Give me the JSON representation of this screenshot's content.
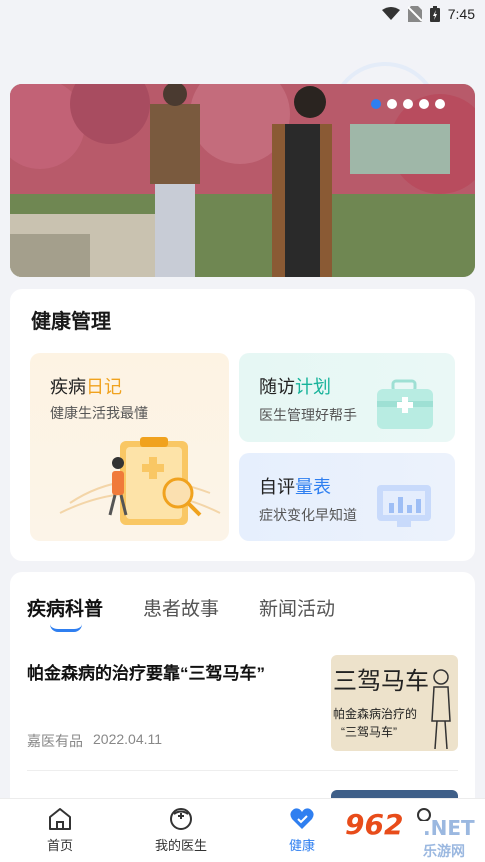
{
  "status": {
    "time": "7:45"
  },
  "banner": {
    "dots": 5,
    "active_dot": 0
  },
  "health": {
    "title": "健康管理",
    "diary": {
      "title_a": "疾病",
      "title_b": "日记",
      "subtitle": "健康生活我最懂"
    },
    "followup": {
      "title_a": "随访",
      "title_b": "计划",
      "subtitle": "医生管理好帮手"
    },
    "selfeval": {
      "title_a": "自评",
      "title_b": "量表",
      "subtitle": "症状变化早知道"
    }
  },
  "news": {
    "tabs": [
      "疾病科普",
      "患者故事",
      "新闻活动"
    ],
    "article": {
      "title": "帕金森病的治疗要靠“三驾马车”",
      "source": "嘉医有品",
      "date": "2022.04.11",
      "thumb_big": "三驾马车",
      "thumb_line1": "帕金森病治疗的",
      "thumb_line2": "“三驾马车”"
    }
  },
  "nav": {
    "items": [
      {
        "label": "首页",
        "icon": "home-icon"
      },
      {
        "label": "我的医生",
        "icon": "doctor-icon"
      },
      {
        "label": "健康",
        "icon": "heart-icon"
      }
    ],
    "active": 2
  },
  "watermark": {
    "number": "962",
    "net": ".NET",
    "site": "乐游网"
  },
  "colors": {
    "accent": "#2f7ff0",
    "orange": "#f0a21e",
    "green": "#17b39a"
  }
}
